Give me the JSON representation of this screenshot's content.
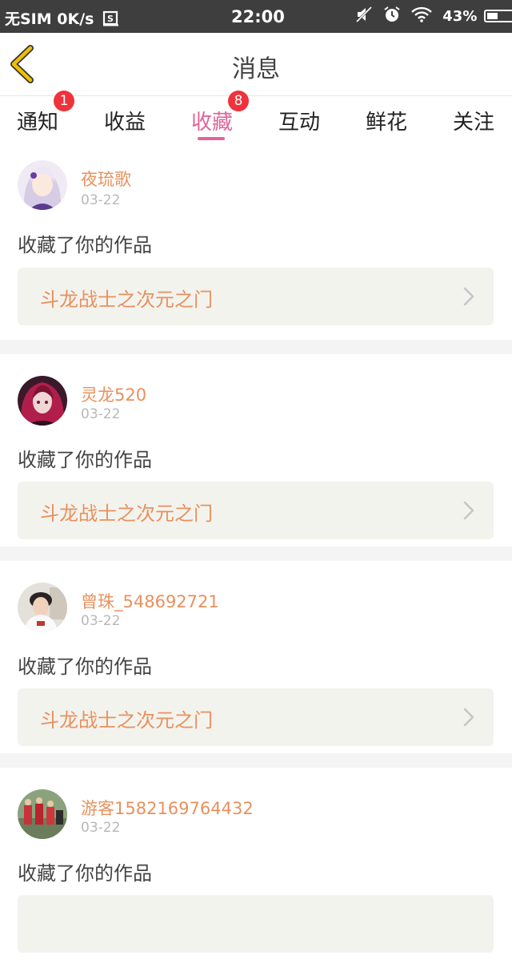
{
  "status_bar": {
    "carrier": "无SIM",
    "net_speed": "0K/s",
    "time": "22:00",
    "battery": "43%",
    "battery_level": 0.43,
    "icons": [
      "sim-icon",
      "mute-icon",
      "alarm-icon",
      "wifi-icon",
      "battery-icon"
    ]
  },
  "header": {
    "title": "消息",
    "back_icon": "chevron-left-icon"
  },
  "tabs": [
    {
      "label": "通知",
      "badge": "1"
    },
    {
      "label": "收益"
    },
    {
      "label": "收藏",
      "badge": "8",
      "active": true
    },
    {
      "label": "互动"
    },
    {
      "label": "鲜花"
    },
    {
      "label": "关注"
    }
  ],
  "colors": {
    "accent": "#e0649b",
    "username": "#e8915e",
    "badge": "#f0323c",
    "back_arrow": "#f0c000"
  },
  "feed": [
    {
      "user": "夜琉歌",
      "date": "03-22",
      "action": "收藏了你的作品",
      "work": "斗龙战士之次元之门"
    },
    {
      "user": "灵龙520",
      "date": "03-22",
      "action": "收藏了你的作品",
      "work": "斗龙战士之次元之门"
    },
    {
      "user": "曾珠_548692721",
      "date": "03-22",
      "action": "收藏了你的作品",
      "work": "斗龙战士之次元之门"
    },
    {
      "user": "游客1582169764432",
      "date": "03-22",
      "action": "收藏了你的作品",
      "work": ""
    }
  ]
}
